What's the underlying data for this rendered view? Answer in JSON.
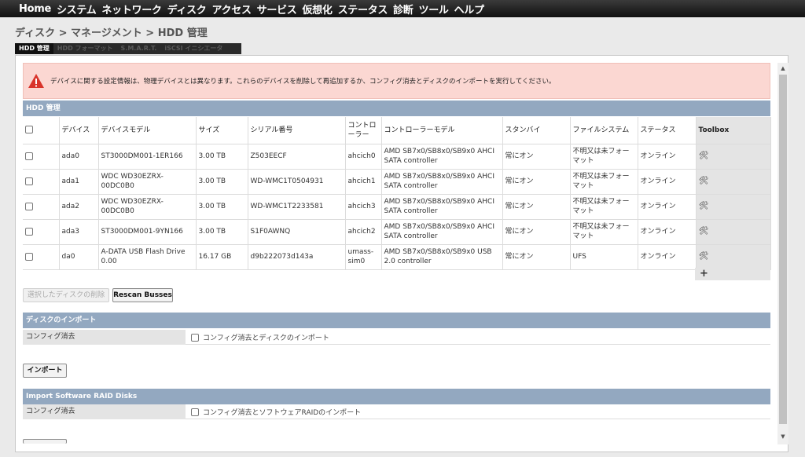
{
  "menu": [
    "Home",
    "システム",
    "ネットワーク",
    "ディスク",
    "アクセス",
    "サービス",
    "仮想化",
    "ステータス",
    "診断",
    "ツール",
    "ヘルプ"
  ],
  "breadcrumb": "ディスク > マネージメント > HDD 管理",
  "tabs": [
    {
      "label": "HDD 管理",
      "active": true
    },
    {
      "label": "HDD フォーマット",
      "active": false
    },
    {
      "label": "S.M.A.R.T.",
      "active": false
    },
    {
      "label": "iSCSI イニシエータ",
      "active": false
    }
  ],
  "warning": {
    "icon": "warning-triangle-icon",
    "text": "デバイスに関する設定情報は、物理デバイスとは異なります。これらのデバイスを削除して再追加するか、コンフィグ消去とディスクのインポートを実行してください。"
  },
  "hdd_section": {
    "title": "HDD 管理",
    "columns": [
      "デバイス",
      "デバイスモデル",
      "サイズ",
      "シリアル番号",
      "コントローラー",
      "コントローラーモデル",
      "スタンバイ",
      "ファイルシステム",
      "ステータス",
      "Toolbox"
    ],
    "rows": [
      {
        "device": "ada0",
        "model": "ST3000DM001-1ER166",
        "size": "3.00 TB",
        "serial": "Z503EECF",
        "controller": "ahcich0",
        "controller_model": "AMD SB7x0/SB8x0/SB9x0 AHCI SATA controller",
        "standby": "常にオン",
        "fs": "不明又は未フォーマット",
        "status": "オンライン"
      },
      {
        "device": "ada1",
        "model": "WDC WD30EZRX-00DC0B0",
        "size": "3.00 TB",
        "serial": "WD-WMC1T0504931",
        "controller": "ahcich1",
        "controller_model": "AMD SB7x0/SB8x0/SB9x0 AHCI SATA controller",
        "standby": "常にオン",
        "fs": "不明又は未フォーマット",
        "status": "オンライン"
      },
      {
        "device": "ada2",
        "model": "WDC WD30EZRX-00DC0B0",
        "size": "3.00 TB",
        "serial": "WD-WMC1T2233581",
        "controller": "ahcich3",
        "controller_model": "AMD SB7x0/SB8x0/SB9x0 AHCI SATA controller",
        "standby": "常にオン",
        "fs": "不明又は未フォーマット",
        "status": "オンライン"
      },
      {
        "device": "ada3",
        "model": "ST3000DM001-9YN166",
        "size": "3.00 TB",
        "serial": "S1F0AWNQ",
        "controller": "ahcich2",
        "controller_model": "AMD SB7x0/SB8x0/SB9x0 AHCI SATA controller",
        "standby": "常にオン",
        "fs": "不明又は未フォーマット",
        "status": "オンライン"
      },
      {
        "device": "da0",
        "model": "A-DATA USB Flash Drive 0.00",
        "size": "16.17 GB",
        "serial": "d9b222073d143a",
        "controller": "umass-sim0",
        "controller_model": "AMD SB7x0/SB8x0/SB9x0 USB 2.0 controller",
        "standby": "常にオン",
        "fs": "UFS",
        "status": "オンライン"
      }
    ],
    "add_symbol": "+",
    "delete_selected_label": "選択したディスクの削除",
    "rescan_label": "Rescan Busses"
  },
  "import_section": {
    "title": "ディスクのインポート",
    "row_label": "コンフィグ消去",
    "checkbox_label": "コンフィグ消去とディスクのインポート",
    "button_label": "インポート"
  },
  "raid_section": {
    "title": "Import Software RAID Disks",
    "row_label": "コンフィグ消去",
    "checkbox_label": "コンフィグ消去とソフトウェアRAIDのインポート"
  },
  "colors": {
    "header_blue": "#93a8c0",
    "warning_bg": "#fbd7d2",
    "warning_icon": "#d9342b"
  }
}
